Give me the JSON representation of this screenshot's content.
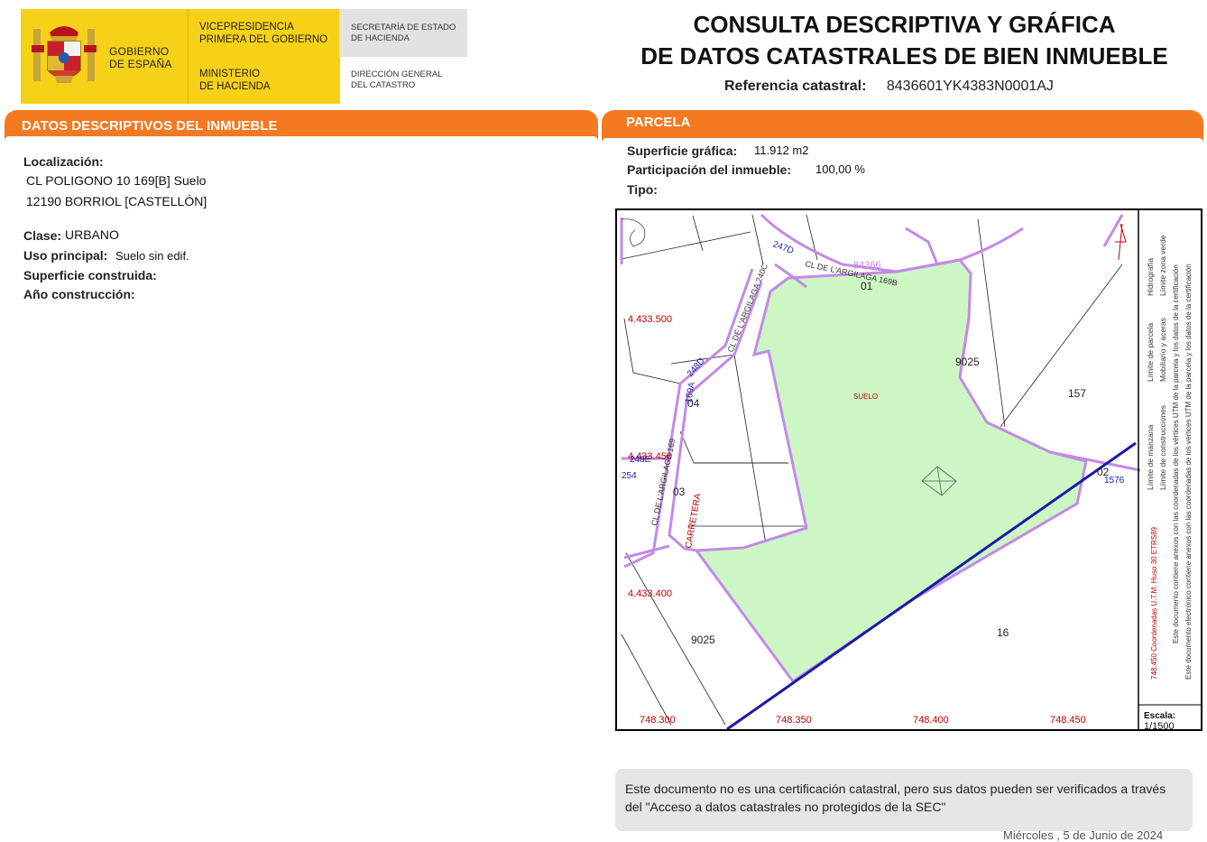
{
  "header": {
    "gobierno": [
      "GOBIERNO",
      "DE ESPAÑA"
    ],
    "vicepresidencia": [
      "VICEPRESIDENCIA",
      "PRIMERA DEL GOBIERNO"
    ],
    "ministerio": [
      "MINISTERIO",
      "DE HACIENDA"
    ],
    "secretaria": [
      "SECRETARÍA DE ESTADO",
      "DE HACIENDA"
    ],
    "direccion": [
      "DIRECCIÓN GENERAL",
      "DEL CATASTRO"
    ],
    "colors": {
      "yellow": "#f7d117",
      "grey": "#e2e2e2",
      "coat": "coat-of-arms-icon"
    }
  },
  "title": {
    "line1": "CONSULTA DESCRIPTIVA Y GRÁFICA",
    "line2": "DE DATOS CATASTRALES DE BIEN INMUEBLE",
    "ref_label": "Referencia catastral:",
    "ref_value": "8436601YK4383N0001AJ"
  },
  "descriptive": {
    "header": "DATOS DESCRIPTIVOS DEL INMUEBLE",
    "localizacion_label": "Localización:",
    "localizacion_line1": "CL POLIGONO 10 169[B] Suelo",
    "localizacion_line2": "12190 BORRIOL [CASTELLÓN]",
    "clase_label": "Clase:",
    "clase_value": "URBANO",
    "uso_label": "Uso principal:",
    "uso_value": "Suelo sin edif.",
    "sup_construida_label": "Superficie construida:",
    "anio_label": "Año construcción:"
  },
  "parcela": {
    "header": "PARCELA",
    "sup_grafica_label": "Superficie gráfica:",
    "sup_grafica_value": "11.912 m2",
    "participacion_label": "Participación del inmueble:",
    "participacion_value": "100,00 %",
    "tipo_label": "Tipo:"
  },
  "map": {
    "colors": {
      "parcel_fill": "#ccf7c4",
      "boundary": "#c389e8",
      "coords": "#c00000",
      "road": "#1a1aa8"
    },
    "y_coords": [
      "4.433.500",
      "4.433.450",
      "4.433.400"
    ],
    "x_coords": [
      "748.300",
      "748.350",
      "748.400",
      "748.450"
    ],
    "parcel_numbers": [
      "9025",
      "157",
      "02",
      "9025",
      "16",
      "04",
      "03",
      "01"
    ],
    "labels": {
      "suelo": "SUELO",
      "street1": "CL DE L'ARGILAGA 169B",
      "street2": "CL DE L'ARGILAGA 240C",
      "street3": "CL DE L'ARGILAGA 169",
      "road": "CARRETERA",
      "n247d": "247D",
      "n248d": "248D",
      "n169a": "169A",
      "n248e": "248E",
      "n254": "254",
      "n1576": "1576",
      "n84366": "84366"
    },
    "legend": {
      "col1": [
        "Límite de manzana",
        "Límite de parcela",
        "Hidrografía"
      ],
      "col2": [
        "Límite de construcciones",
        "Mobiliario y aceras",
        "Límite zona verde"
      ],
      "col3": "Este documento contiene anexos con las coordenadas de los vértices UTM de la parcela y los datos de la certificación",
      "col4": "Este documento electrónico contiene anexos con las coordenadas de los vértices UTM de la parcela y los datos de la certificación",
      "coord_note": "748.450  Coordenadas U.T.M. Huso 30 ETRS89"
    },
    "scale_label": "Escala:",
    "scale_value": "1/1500",
    "north": "N"
  },
  "footer": {
    "note": "Este documento no es una certificación catastral, pero sus datos pueden ser verificados a través del \"Acceso a datos catastrales no protegidos de la SEC\"",
    "date": "Miércoles , 5 de Junio de 2024"
  }
}
